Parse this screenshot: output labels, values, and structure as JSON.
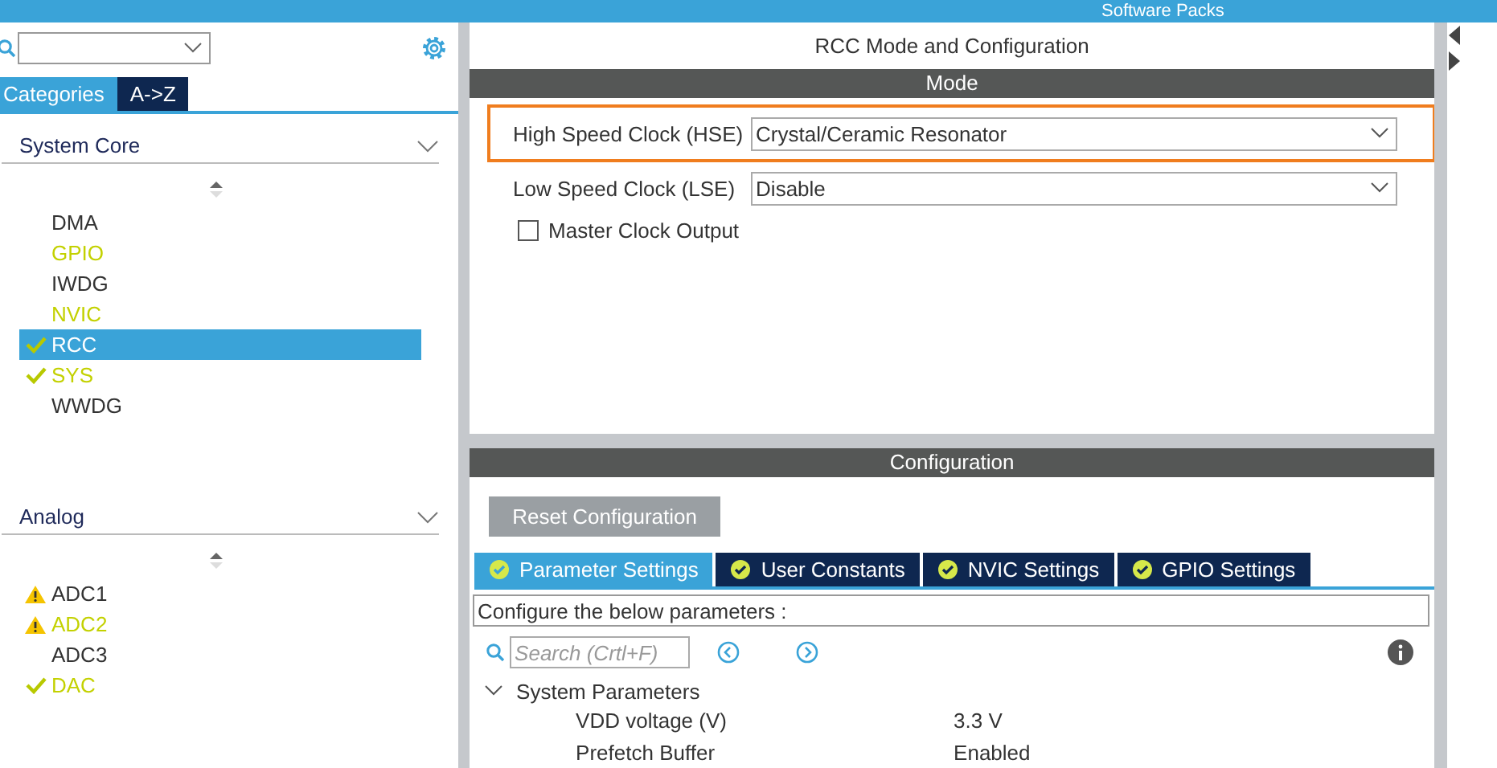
{
  "top_bar": {
    "title": "Software Packs"
  },
  "sidebar": {
    "tabs": [
      {
        "label": "Categories",
        "selected": true
      },
      {
        "label": "A->Z",
        "selected": false
      }
    ],
    "groups": [
      {
        "title": "System Core",
        "expanded": true,
        "items": [
          {
            "label": "DMA",
            "kind": "none",
            "color": "#333333",
            "selected": false
          },
          {
            "label": "GPIO",
            "kind": "none",
            "color": "#c3d100",
            "selected": false
          },
          {
            "label": "IWDG",
            "kind": "none",
            "color": "#333333",
            "selected": false
          },
          {
            "label": "NVIC",
            "kind": "none",
            "color": "#c3d100",
            "selected": false
          },
          {
            "label": "RCC",
            "kind": "check",
            "color": "#ffffff",
            "selected": true
          },
          {
            "label": "SYS",
            "kind": "check",
            "color": "#c3d100",
            "selected": false
          },
          {
            "label": "WWDG",
            "kind": "none",
            "color": "#333333",
            "selected": false
          }
        ]
      },
      {
        "title": "Analog",
        "expanded": true,
        "items": [
          {
            "label": "ADC1",
            "kind": "warning",
            "color": "#333333",
            "selected": false
          },
          {
            "label": "ADC2",
            "kind": "warning",
            "color": "#c3d100",
            "selected": false
          },
          {
            "label": "ADC3",
            "kind": "none",
            "color": "#333333",
            "selected": false
          },
          {
            "label": "DAC",
            "kind": "check",
            "color": "#c3d100",
            "selected": false
          }
        ]
      }
    ]
  },
  "main": {
    "title": "RCC Mode and Configuration",
    "mode": {
      "title": "Mode",
      "fields": [
        {
          "label": "High Speed Clock (HSE)",
          "value": "Crystal/Ceramic Resonator",
          "highlighted": true
        },
        {
          "label": "Low Speed Clock (LSE)",
          "value": "Disable",
          "highlighted": false
        }
      ],
      "checkbox": {
        "label": "Master Clock Output",
        "checked": false
      }
    },
    "configuration": {
      "title": "Configuration",
      "reset_button": "Reset Configuration",
      "tabs": [
        {
          "label": "Parameter Settings",
          "selected": true
        },
        {
          "label": "User Constants",
          "selected": false
        },
        {
          "label": "NVIC Settings",
          "selected": false
        },
        {
          "label": "GPIO Settings",
          "selected": false
        }
      ],
      "hint": "Configure the below parameters :",
      "search": {
        "placeholder": "Search (Crtl+F)"
      },
      "section": {
        "title": "System Parameters",
        "expanded": true,
        "rows": [
          {
            "name": "VDD voltage (V)",
            "value": "3.3 V"
          },
          {
            "name": "Prefetch Buffer",
            "value": "Enabled"
          }
        ]
      }
    }
  }
}
